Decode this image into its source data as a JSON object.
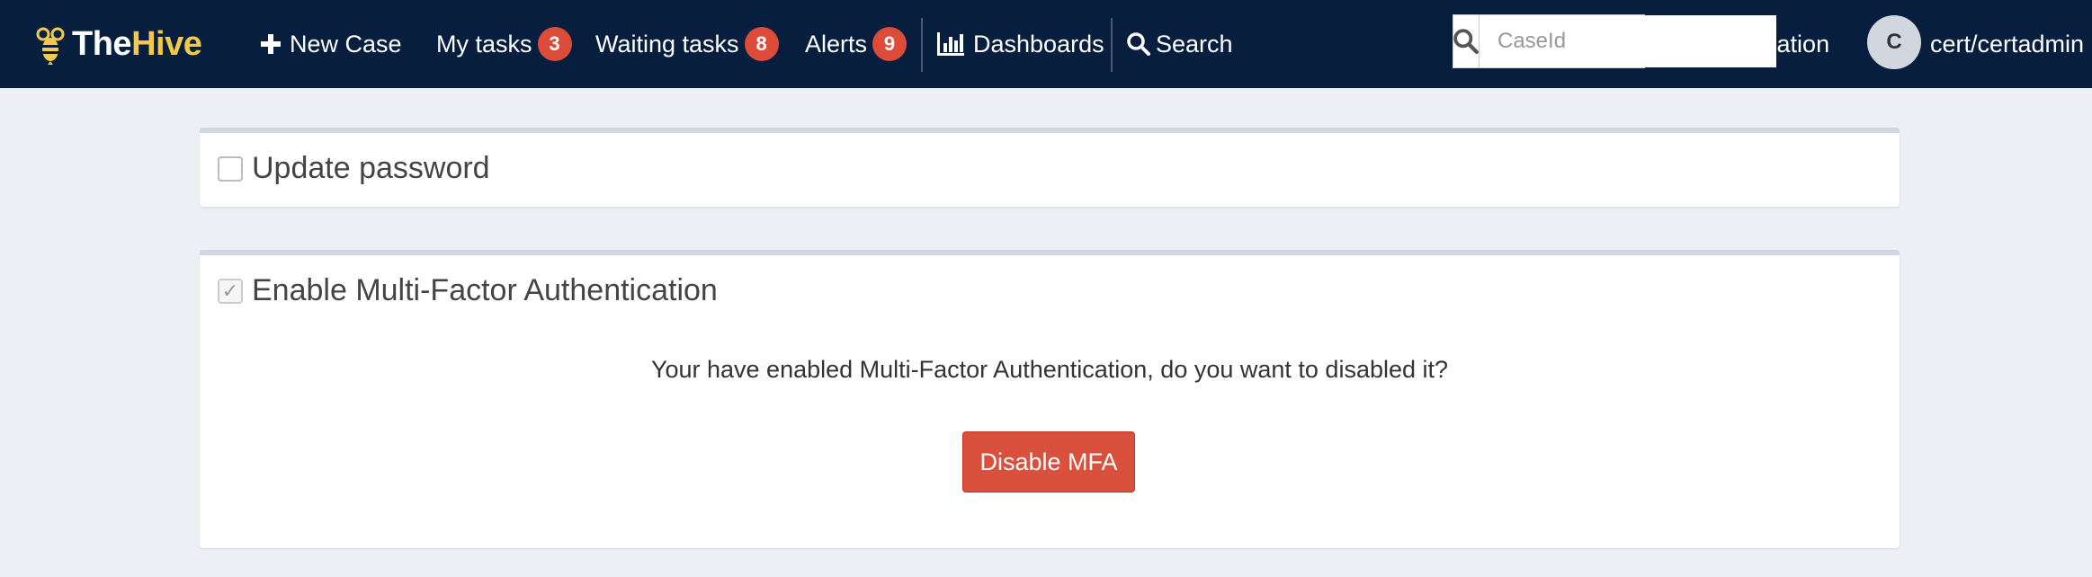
{
  "navbar": {
    "brand": {
      "part1": "The",
      "part2": "Hive",
      "logo_icon": "bee-icon",
      "accent": "#f2c94c"
    },
    "new_case": {
      "label": "New Case",
      "icon": "plus-icon"
    },
    "my_tasks": {
      "label": "My tasks",
      "count": "3"
    },
    "waiting_tasks": {
      "label": "Waiting tasks",
      "count": "8"
    },
    "alerts": {
      "label": "Alerts",
      "count": "9"
    },
    "dashboards": {
      "label": "Dashboards",
      "icon": "bar-chart-icon"
    },
    "search": {
      "label": "Search",
      "icon": "search-icon"
    },
    "case_search": {
      "placeholder": "CaseId",
      "value": "",
      "icon": "search-icon"
    },
    "organisation": {
      "label": "Organisation",
      "icon": "building-icon"
    },
    "user": {
      "avatar_initial": "C",
      "name": "cert/certadmin"
    },
    "colors": {
      "background": "#071e3f",
      "badge": "#dd4b39"
    }
  },
  "update_password": {
    "title": "Update password",
    "checked": false
  },
  "mfa": {
    "title": "Enable Multi-Factor Authentication",
    "checked": true,
    "message": "Your have enabled Multi-Factor Authentication, do you want to disabled it?",
    "disable_button": "Disable MFA",
    "button_color": "#d9503d"
  }
}
